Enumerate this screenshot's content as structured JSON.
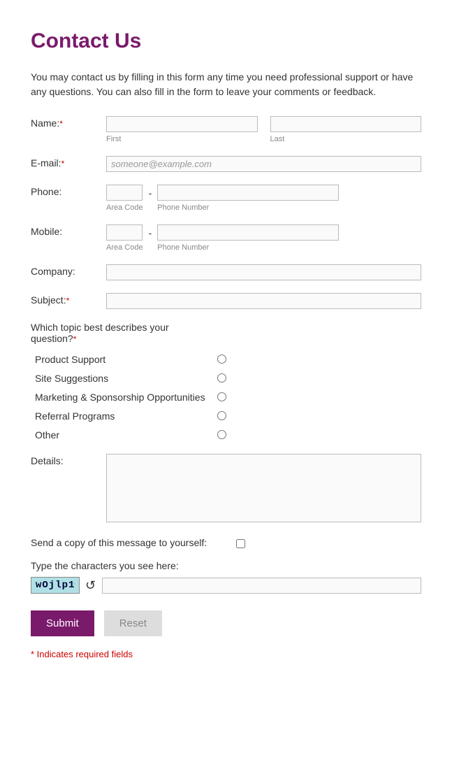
{
  "heading": "Contact Us",
  "intro": "You may contact us by filling in this form any time you need professional support or have any questions. You can also fill in the form to leave your comments or feedback.",
  "fields": {
    "name": {
      "label": "Name:",
      "first_sub": "First",
      "last_sub": "Last"
    },
    "email": {
      "label": "E-mail:",
      "placeholder": "someone@example.com"
    },
    "phone": {
      "label": "Phone:",
      "area_sub": "Area Code",
      "num_sub": "Phone Number"
    },
    "mobile": {
      "label": "Mobile:",
      "area_sub": "Area Code",
      "num_sub": "Phone Number"
    },
    "company": {
      "label": "Company:"
    },
    "subject": {
      "label": "Subject:"
    },
    "details": {
      "label": "Details:"
    }
  },
  "topic": {
    "question": "Which topic best describes your question?",
    "options": [
      "Product Support",
      "Site Suggestions",
      "Marketing & Sponsorship Opportunities",
      "Referral Programs",
      "Other"
    ]
  },
  "copy_self": "Send a copy of this message to yourself:",
  "captcha": {
    "label": "Type the characters you see here:",
    "text": "wOjlp1"
  },
  "buttons": {
    "submit": "Submit",
    "reset": "Reset"
  },
  "required_note": "* Indicates required fields",
  "asterisk": "*",
  "dash": "-"
}
